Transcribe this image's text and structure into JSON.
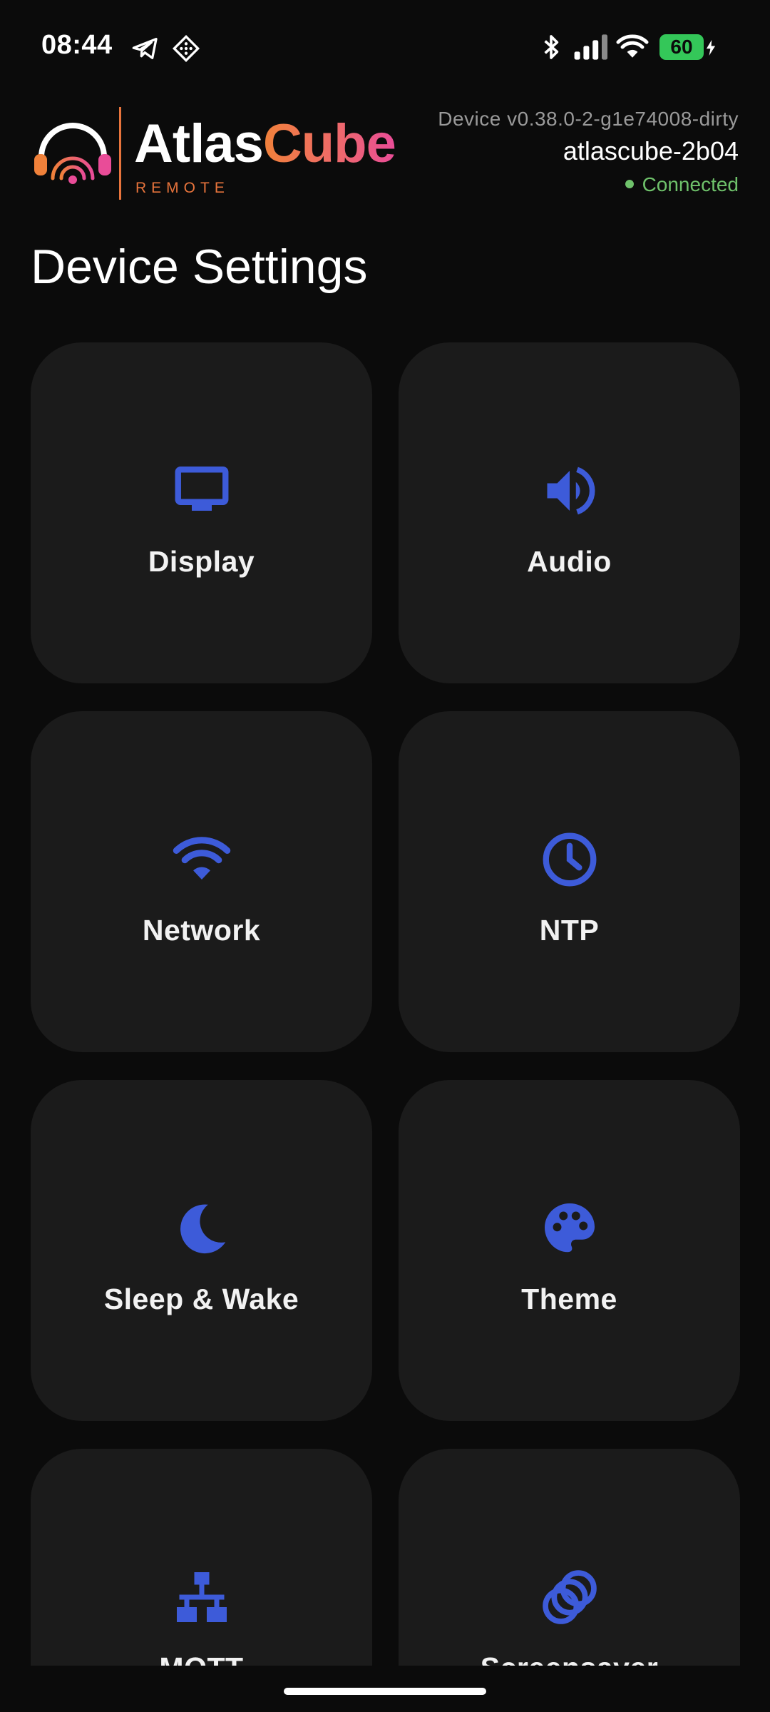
{
  "status_bar": {
    "time": "08:44",
    "left_icons": [
      "telegram-icon",
      "app-notification-icon"
    ],
    "right_icons": [
      "bluetooth-icon",
      "signal-icon",
      "wifi-icon"
    ],
    "battery_level": "60",
    "charging": true
  },
  "header": {
    "logo_primary": "Atlas",
    "logo_accent": "Cube",
    "logo_sub": "REMOTE",
    "device_version": "Device v0.38.0-2-g1e74008-dirty",
    "device_name": "atlascube-2b04",
    "connection_status": "Connected"
  },
  "page": {
    "title": "Device Settings"
  },
  "colors": {
    "background": "#0b0b0b",
    "card": "#1b1b1b",
    "icon_accent": "#3d5bd9",
    "connected": "#6fc26b",
    "brand_orange": "#e8743c",
    "brand_pink": "#e94c98"
  },
  "settings": [
    {
      "label": "Display",
      "icon": "monitor-icon"
    },
    {
      "label": "Audio",
      "icon": "speaker-icon"
    },
    {
      "label": "Network",
      "icon": "wifi-icon"
    },
    {
      "label": "NTP",
      "icon": "clock-icon"
    },
    {
      "label": "Sleep & Wake",
      "icon": "moon-icon"
    },
    {
      "label": "Theme",
      "icon": "palette-icon"
    },
    {
      "label": "MQTT",
      "icon": "network-tree-icon"
    },
    {
      "label": "Screensaver",
      "icon": "rings-icon"
    }
  ]
}
